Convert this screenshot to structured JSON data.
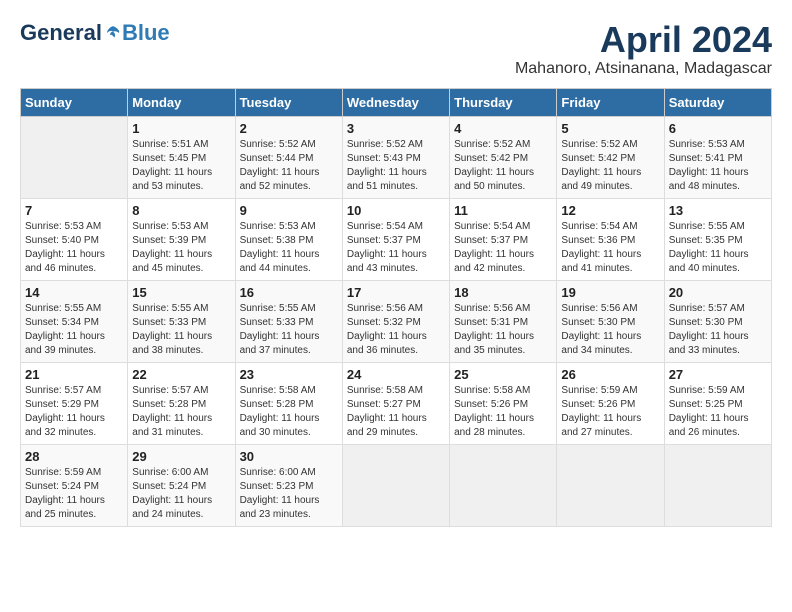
{
  "header": {
    "logo": {
      "general": "General",
      "blue": "Blue"
    },
    "title": "April 2024",
    "location": "Mahanoro, Atsinanana, Madagascar"
  },
  "days_of_week": [
    "Sunday",
    "Monday",
    "Tuesday",
    "Wednesday",
    "Thursday",
    "Friday",
    "Saturday"
  ],
  "weeks": [
    [
      {
        "day": "",
        "sunrise": "",
        "sunset": "",
        "daylight": ""
      },
      {
        "day": "1",
        "sunrise": "5:51 AM",
        "sunset": "5:45 PM",
        "daylight": "11 hours and 53 minutes."
      },
      {
        "day": "2",
        "sunrise": "5:52 AM",
        "sunset": "5:44 PM",
        "daylight": "11 hours and 52 minutes."
      },
      {
        "day": "3",
        "sunrise": "5:52 AM",
        "sunset": "5:43 PM",
        "daylight": "11 hours and 51 minutes."
      },
      {
        "day": "4",
        "sunrise": "5:52 AM",
        "sunset": "5:42 PM",
        "daylight": "11 hours and 50 minutes."
      },
      {
        "day": "5",
        "sunrise": "5:52 AM",
        "sunset": "5:42 PM",
        "daylight": "11 hours and 49 minutes."
      },
      {
        "day": "6",
        "sunrise": "5:53 AM",
        "sunset": "5:41 PM",
        "daylight": "11 hours and 48 minutes."
      }
    ],
    [
      {
        "day": "7",
        "sunrise": "5:53 AM",
        "sunset": "5:40 PM",
        "daylight": "11 hours and 46 minutes."
      },
      {
        "day": "8",
        "sunrise": "5:53 AM",
        "sunset": "5:39 PM",
        "daylight": "11 hours and 45 minutes."
      },
      {
        "day": "9",
        "sunrise": "5:53 AM",
        "sunset": "5:38 PM",
        "daylight": "11 hours and 44 minutes."
      },
      {
        "day": "10",
        "sunrise": "5:54 AM",
        "sunset": "5:37 PM",
        "daylight": "11 hours and 43 minutes."
      },
      {
        "day": "11",
        "sunrise": "5:54 AM",
        "sunset": "5:37 PM",
        "daylight": "11 hours and 42 minutes."
      },
      {
        "day": "12",
        "sunrise": "5:54 AM",
        "sunset": "5:36 PM",
        "daylight": "11 hours and 41 minutes."
      },
      {
        "day": "13",
        "sunrise": "5:55 AM",
        "sunset": "5:35 PM",
        "daylight": "11 hours and 40 minutes."
      }
    ],
    [
      {
        "day": "14",
        "sunrise": "5:55 AM",
        "sunset": "5:34 PM",
        "daylight": "11 hours and 39 minutes."
      },
      {
        "day": "15",
        "sunrise": "5:55 AM",
        "sunset": "5:33 PM",
        "daylight": "11 hours and 38 minutes."
      },
      {
        "day": "16",
        "sunrise": "5:55 AM",
        "sunset": "5:33 PM",
        "daylight": "11 hours and 37 minutes."
      },
      {
        "day": "17",
        "sunrise": "5:56 AM",
        "sunset": "5:32 PM",
        "daylight": "11 hours and 36 minutes."
      },
      {
        "day": "18",
        "sunrise": "5:56 AM",
        "sunset": "5:31 PM",
        "daylight": "11 hours and 35 minutes."
      },
      {
        "day": "19",
        "sunrise": "5:56 AM",
        "sunset": "5:30 PM",
        "daylight": "11 hours and 34 minutes."
      },
      {
        "day": "20",
        "sunrise": "5:57 AM",
        "sunset": "5:30 PM",
        "daylight": "11 hours and 33 minutes."
      }
    ],
    [
      {
        "day": "21",
        "sunrise": "5:57 AM",
        "sunset": "5:29 PM",
        "daylight": "11 hours and 32 minutes."
      },
      {
        "day": "22",
        "sunrise": "5:57 AM",
        "sunset": "5:28 PM",
        "daylight": "11 hours and 31 minutes."
      },
      {
        "day": "23",
        "sunrise": "5:58 AM",
        "sunset": "5:28 PM",
        "daylight": "11 hours and 30 minutes."
      },
      {
        "day": "24",
        "sunrise": "5:58 AM",
        "sunset": "5:27 PM",
        "daylight": "11 hours and 29 minutes."
      },
      {
        "day": "25",
        "sunrise": "5:58 AM",
        "sunset": "5:26 PM",
        "daylight": "11 hours and 28 minutes."
      },
      {
        "day": "26",
        "sunrise": "5:59 AM",
        "sunset": "5:26 PM",
        "daylight": "11 hours and 27 minutes."
      },
      {
        "day": "27",
        "sunrise": "5:59 AM",
        "sunset": "5:25 PM",
        "daylight": "11 hours and 26 minutes."
      }
    ],
    [
      {
        "day": "28",
        "sunrise": "5:59 AM",
        "sunset": "5:24 PM",
        "daylight": "11 hours and 25 minutes."
      },
      {
        "day": "29",
        "sunrise": "6:00 AM",
        "sunset": "5:24 PM",
        "daylight": "11 hours and 24 minutes."
      },
      {
        "day": "30",
        "sunrise": "6:00 AM",
        "sunset": "5:23 PM",
        "daylight": "11 hours and 23 minutes."
      },
      {
        "day": "",
        "sunrise": "",
        "sunset": "",
        "daylight": ""
      },
      {
        "day": "",
        "sunrise": "",
        "sunset": "",
        "daylight": ""
      },
      {
        "day": "",
        "sunrise": "",
        "sunset": "",
        "daylight": ""
      },
      {
        "day": "",
        "sunrise": "",
        "sunset": "",
        "daylight": ""
      }
    ]
  ],
  "labels": {
    "sunrise": "Sunrise:",
    "sunset": "Sunset:",
    "daylight": "Daylight:"
  }
}
